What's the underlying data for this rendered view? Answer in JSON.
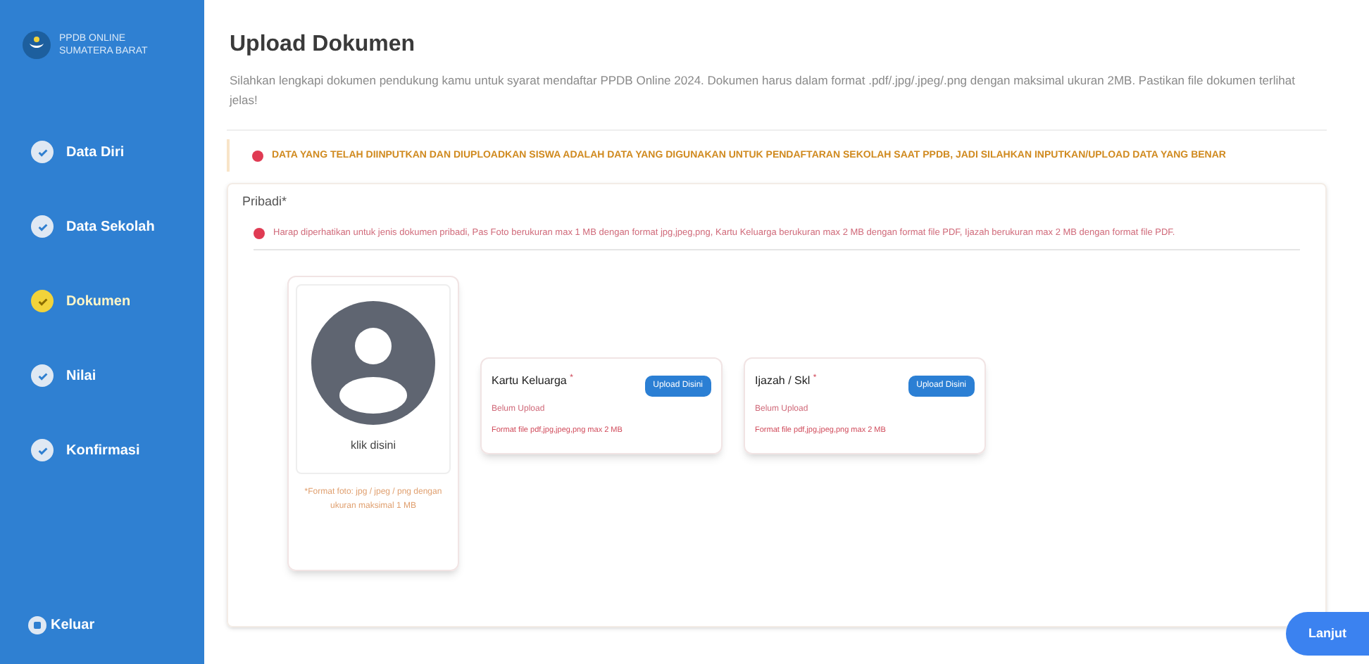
{
  "sidebar": {
    "brand": [
      "PPDB ONLINE",
      "SUMATERA BARAT"
    ],
    "steps": [
      {
        "label": "Data Diri",
        "selected": false
      },
      {
        "label": "Data Sekolah",
        "selected": false
      },
      {
        "label": "Dokumen",
        "selected": true
      },
      {
        "label": "Nilai",
        "selected": false
      },
      {
        "label": "Konfirmasi",
        "selected": false
      }
    ],
    "logout": "Keluar"
  },
  "header": {
    "title": "Upload Dokumen",
    "description": "Silahkan lengkapi dokumen pendukung kamu untuk syarat mendaftar PPDB Online 2024. Dokumen harus dalam format .pdf/.jpg/.jpeg/.png dengan maksimal ukuran 2MB. Pastikan file dokumen terlihat jelas!"
  },
  "warning": "DATA YANG TELAH DIINPUTKAN DAN DIUPLOADKAN SISWA ADALAH DATA YANG DIGUNAKAN UNTUK PENDAFTARAN SEKOLAH SAAT PPDB, JADI SILAHKAN INPUTKAN/UPLOAD DATA YANG BENAR",
  "section": {
    "title": "Pribadi*",
    "note": "Harap diperhatikan untuk jenis dokumen pribadi, Pas Foto berukuran max 1 MB dengan format jpg,jpeg,png, Kartu Keluarga berukuran max 2 MB dengan format file PDF, Ijazah berukuran max 2 MB dengan format file PDF.",
    "photo": {
      "label": "klik disini",
      "hint": "*Format foto: jpg / jpeg / png dengan ukuran maksimal 1 MB"
    },
    "documents": [
      {
        "title": "Kartu Keluarga",
        "required": "*",
        "button": "Upload Disini",
        "status": "Belum Upload",
        "hint": "Format file pdf,jpg,jpeg,png max 2 MB"
      },
      {
        "title": "Ijazah / Skl",
        "required": "*",
        "button": "Upload Disini",
        "status": "Belum Upload",
        "hint": "Format file pdf,jpg,jpeg,png max 2 MB"
      }
    ]
  },
  "next_button": "Lanjut"
}
